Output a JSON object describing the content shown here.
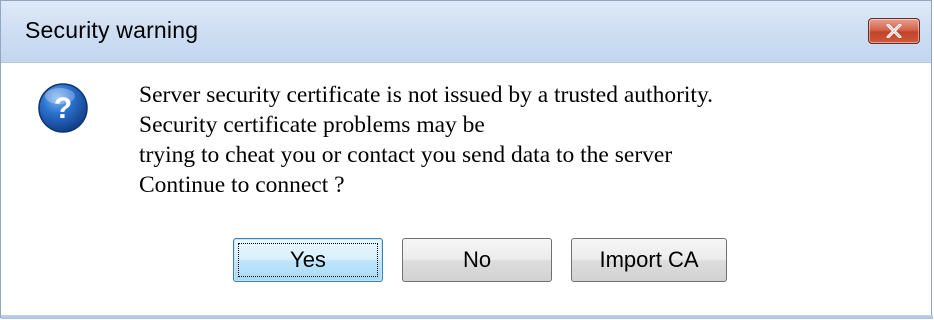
{
  "window": {
    "title": "Security warning",
    "close_icon": "close-icon"
  },
  "dialog": {
    "icon": "question-icon",
    "message_lines": [
      "Server security certificate is not issued by a trusted authority.",
      "Security certificate problems may be",
      "trying to cheat you or contact you send data to the server",
      "Continue to connect ?"
    ]
  },
  "buttons": {
    "yes_label": "Yes",
    "no_label": "No",
    "import_label": "Import CA"
  },
  "colors": {
    "titlebar": "#cfdff3",
    "close_button": "#c9563c",
    "icon_blue": "#1f5fb5",
    "default_button_border": "#3c7fb1"
  }
}
